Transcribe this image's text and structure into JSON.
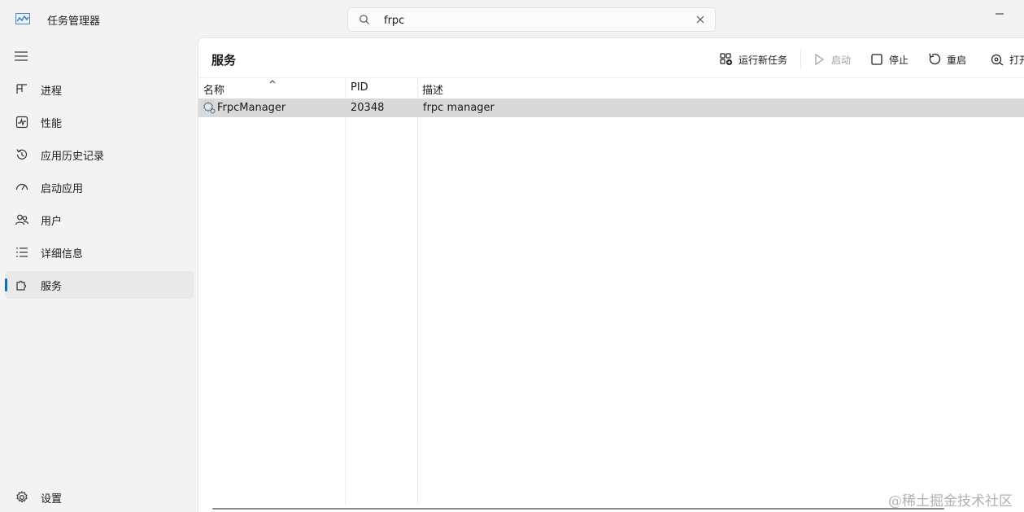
{
  "app": {
    "title": "任务管理器",
    "icon": "task-manager-chart-icon"
  },
  "search": {
    "value": "frpc"
  },
  "sidebar": {
    "items": [
      {
        "label": "进程",
        "icon": "processes-grid-icon",
        "active": false
      },
      {
        "label": "性能",
        "icon": "performance-pulse-icon",
        "active": false
      },
      {
        "label": "应用历史记录",
        "icon": "history-clock-icon",
        "active": false
      },
      {
        "label": "启动应用",
        "icon": "startup-gauge-icon",
        "active": false
      },
      {
        "label": "用户",
        "icon": "users-icon",
        "active": false
      },
      {
        "label": "详细信息",
        "icon": "details-list-icon",
        "active": false
      },
      {
        "label": "服务",
        "icon": "services-puzzle-icon",
        "active": true
      }
    ],
    "settings": {
      "label": "设置",
      "icon": "gear-icon"
    }
  },
  "main": {
    "title": "服务",
    "toolbar": {
      "run_new_task": "运行新任务",
      "start": "启动",
      "stop": "停止",
      "restart": "重启",
      "open_truncated": "打开"
    },
    "table": {
      "columns": [
        "名称",
        "PID",
        "描述"
      ],
      "rows": [
        {
          "name": "FrpcManager",
          "pid": "20348",
          "description": "frpc manager"
        }
      ]
    }
  },
  "watermark": "@稀土掘金技术社区",
  "colors": {
    "accent": "#0f6cbd",
    "selected_row": "#d9d9d9",
    "sidebar_bg": "#f3f3f3"
  }
}
